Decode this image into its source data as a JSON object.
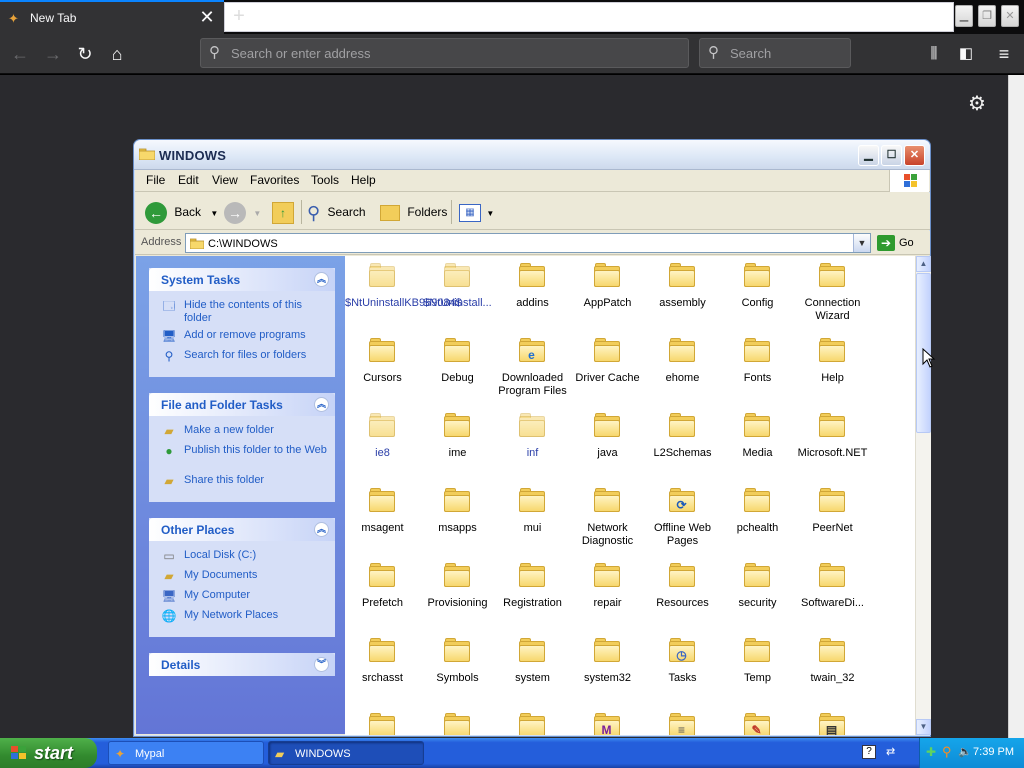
{
  "browser": {
    "tab_title": "New Tab",
    "tab_close": "✕",
    "new_tab": "+",
    "url_placeholder": "Search or enter address",
    "search_placeholder": "Search"
  },
  "window": {
    "title": "WINDOWS"
  },
  "menu": [
    "File",
    "Edit",
    "View",
    "Favorites",
    "Tools",
    "Help"
  ],
  "toolbar": {
    "back_label": "Back",
    "search_label": "Search",
    "folders_label": "Folders"
  },
  "address": {
    "label": "Address",
    "value": "C:\\WINDOWS",
    "go_label": "Go"
  },
  "taskpane": {
    "system_tasks": {
      "title": "System Tasks",
      "items": [
        "Hide the contents of this folder",
        "Add or remove programs",
        "Search for files or folders"
      ]
    },
    "file_folder_tasks": {
      "title": "File and Folder Tasks",
      "items": [
        "Make a new folder",
        "Publish this folder to the Web",
        "Share this folder"
      ]
    },
    "other_places": {
      "title": "Other Places",
      "items": [
        "Local Disk (C:)",
        "My Documents",
        "My Computer",
        "My Network Places"
      ]
    },
    "details": {
      "title": "Details"
    }
  },
  "files": [
    {
      "name": "$NtUninstallKB969084$",
      "hidden": true
    },
    {
      "name": "$NtUninstall...",
      "hidden": true
    },
    {
      "name": "addins"
    },
    {
      "name": "AppPatch"
    },
    {
      "name": "assembly"
    },
    {
      "name": "Config"
    },
    {
      "name": "Connection Wizard"
    },
    {
      "name": "Cursors"
    },
    {
      "name": "Debug"
    },
    {
      "name": "Downloaded Program Files",
      "overlay": "e"
    },
    {
      "name": "Driver Cache"
    },
    {
      "name": "ehome"
    },
    {
      "name": "Fonts"
    },
    {
      "name": "Help"
    },
    {
      "name": "ie8",
      "hidden": true
    },
    {
      "name": "ime"
    },
    {
      "name": "inf",
      "hidden": true
    },
    {
      "name": "java"
    },
    {
      "name": "L2Schemas"
    },
    {
      "name": "Media"
    },
    {
      "name": "Microsoft.NET"
    },
    {
      "name": "msagent"
    },
    {
      "name": "msapps"
    },
    {
      "name": "mui"
    },
    {
      "name": "Network Diagnostic"
    },
    {
      "name": "Offline Web Pages",
      "overlay": "sync"
    },
    {
      "name": "pchealth"
    },
    {
      "name": "PeerNet"
    },
    {
      "name": "Prefetch"
    },
    {
      "name": "Provisioning"
    },
    {
      "name": "Registration"
    },
    {
      "name": "repair"
    },
    {
      "name": "Resources"
    },
    {
      "name": "security"
    },
    {
      "name": "SoftwareDi..."
    },
    {
      "name": "srchasst"
    },
    {
      "name": "Symbols"
    },
    {
      "name": "system"
    },
    {
      "name": "system32"
    },
    {
      "name": "Tasks",
      "overlay": "clock"
    },
    {
      "name": "Temp"
    },
    {
      "name": "twain_32"
    },
    {
      "name": ""
    },
    {
      "name": ""
    },
    {
      "name": ""
    },
    {
      "name": "",
      "overlay": "msg"
    },
    {
      "name": "",
      "overlay": "doc"
    },
    {
      "name": "",
      "overlay": "paint"
    },
    {
      "name": "",
      "overlay": "doc2"
    }
  ],
  "taskbar": {
    "start": "start",
    "tasks": [
      {
        "label": "Mypal",
        "active": false
      },
      {
        "label": "WINDOWS",
        "active": true
      }
    ],
    "clock": "7:39 PM"
  },
  "colors": {
    "firefox_dark": "#323234",
    "xp_blue": "#245edb",
    "folder_yellow": "#f2cd5a",
    "task_link": "#215dc6"
  }
}
